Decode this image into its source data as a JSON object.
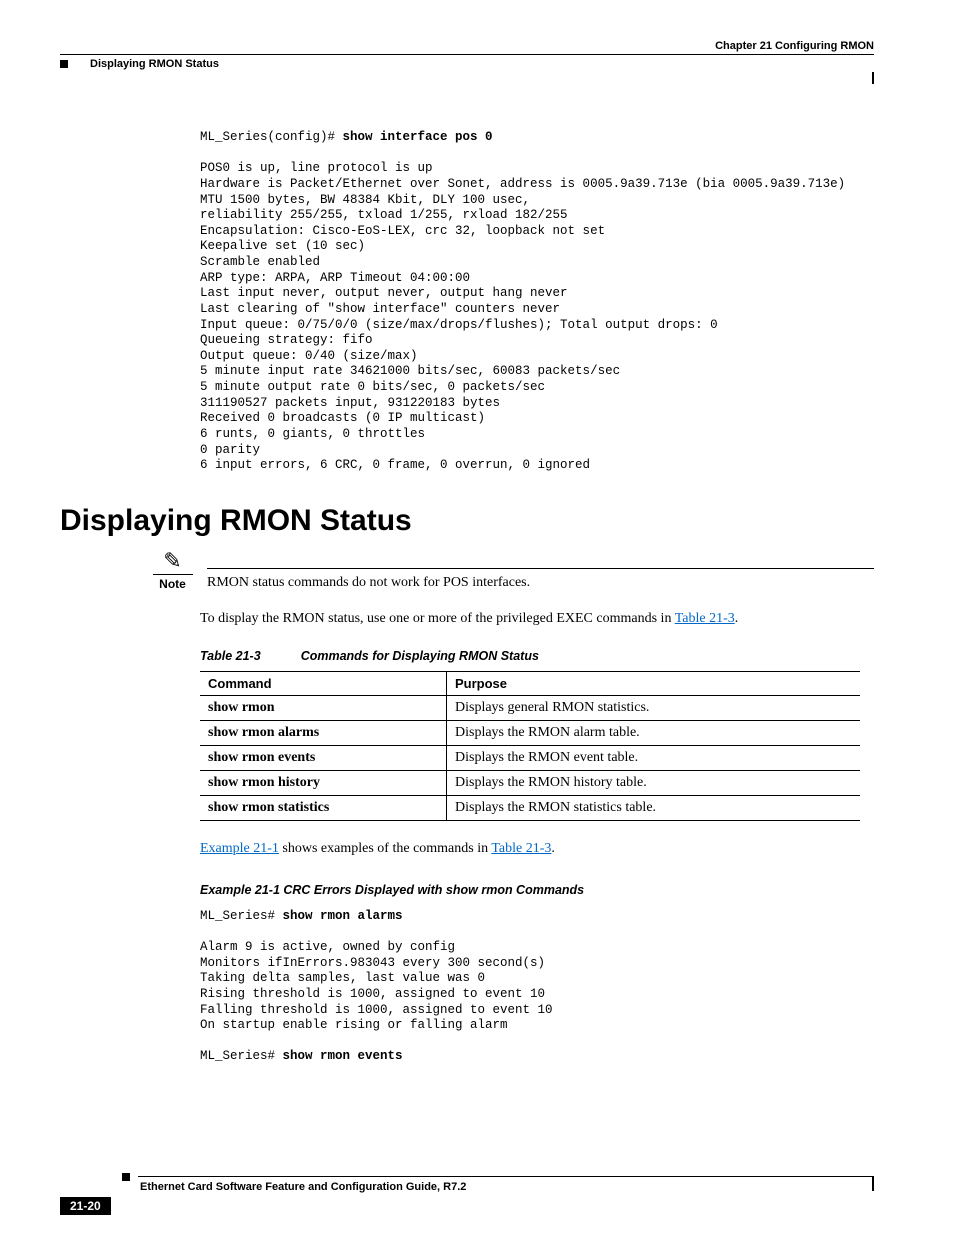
{
  "header": {
    "chapter": "Chapter 21 Configuring RMON",
    "section_running": "Displaying RMON Status"
  },
  "cli1": {
    "prefix": "ML_Series(config)# ",
    "cmd": "show interface pos 0",
    "output": "POS0 is up, line protocol is up\nHardware is Packet/Ethernet over Sonet, address is 0005.9a39.713e (bia 0005.9a39.713e)\nMTU 1500 bytes, BW 48384 Kbit, DLY 100 usec,\nreliability 255/255, txload 1/255, rxload 182/255\nEncapsulation: Cisco-EoS-LEX, crc 32, loopback not set\nKeepalive set (10 sec)\nScramble enabled\nARP type: ARPA, ARP Timeout 04:00:00\nLast input never, output never, output hang never\nLast clearing of \"show interface\" counters never\nInput queue: 0/75/0/0 (size/max/drops/flushes); Total output drops: 0\nQueueing strategy: fifo\nOutput queue: 0/40 (size/max)\n5 minute input rate 34621000 bits/sec, 60083 packets/sec\n5 minute output rate 0 bits/sec, 0 packets/sec\n311190527 packets input, 931220183 bytes\nReceived 0 broadcasts (0 IP multicast)\n6 runts, 0 giants, 0 throttles\n0 parity\n6 input errors, 6 CRC, 0 frame, 0 overrun, 0 ignored"
  },
  "heading": "Displaying RMON Status",
  "note": {
    "label": "Note",
    "text": "RMON status commands do not work for POS interfaces."
  },
  "para1": {
    "pre": "To display the RMON status, use one or more of the privileged EXEC commands in ",
    "link": "Table 21-3",
    "post": "."
  },
  "table": {
    "caption_num": "Table 21-3",
    "caption_text": "Commands for Displaying RMON Status",
    "head_cmd": "Command",
    "head_purpose": "Purpose",
    "rows": [
      {
        "cmd": "show rmon",
        "purpose": "Displays general RMON statistics."
      },
      {
        "cmd": "show rmon alarms",
        "purpose": "Displays the RMON alarm table."
      },
      {
        "cmd": "show rmon events",
        "purpose": "Displays the RMON event table."
      },
      {
        "cmd": "show rmon history",
        "purpose": "Displays the RMON history table."
      },
      {
        "cmd": "show rmon statistics",
        "purpose": "Displays the RMON statistics table."
      }
    ]
  },
  "para2": {
    "link1": "Example 21-1",
    "mid": " shows examples of the commands in ",
    "link2": "Table 21-3",
    "post": "."
  },
  "example": {
    "title": "Example 21-1   CRC Errors Displayed with show rmon Commands",
    "prefix1": "ML_Series# ",
    "cmd1": "show rmon alarms",
    "out1": "Alarm 9 is active, owned by config\nMonitors ifInErrors.983043 every 300 second(s)\nTaking delta samples, last value was 0\nRising threshold is 1000, assigned to event 10\nFalling threshold is 1000, assigned to event 10\nOn startup enable rising or falling alarm",
    "prefix2": "ML_Series# ",
    "cmd2": "show rmon events"
  },
  "footer": {
    "book": "Ethernet Card Software Feature and Configuration Guide, R7.2",
    "page": "21-20"
  }
}
